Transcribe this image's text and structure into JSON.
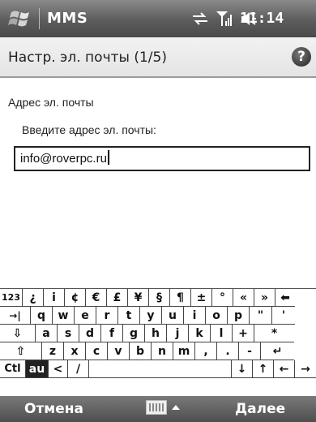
{
  "statusbar": {
    "app_name": "MMS",
    "time": "11:14",
    "icons": [
      "windows-logo",
      "sync-icon",
      "signal-icon",
      "volume-icon"
    ]
  },
  "header": {
    "title": "Настр. эл. почты (1/5)",
    "help_icon": "?"
  },
  "form": {
    "section_label": "Адрес эл. почты",
    "field_label": "Введите адрес эл. почты:",
    "email_value": "info@roverpc.ru"
  },
  "keyboard": {
    "rows": [
      [
        "123",
        "¿",
        "i",
        "¢",
        "€",
        "£",
        "¥",
        "§",
        "¶",
        "±",
        "°",
        "«",
        "»",
        "⬅"
      ],
      [
        "→|",
        "q",
        "w",
        "e",
        "r",
        "t",
        "y",
        "u",
        "i",
        "o",
        "p",
        "\"",
        "'"
      ],
      [
        "⇩",
        "a",
        "s",
        "d",
        "f",
        "g",
        "h",
        "j",
        "k",
        "l",
        "+",
        "*"
      ],
      [
        "⇧",
        "z",
        "x",
        "c",
        "v",
        "b",
        "n",
        "m",
        ",",
        ".",
        "-",
        "↵"
      ],
      [
        "Ctl",
        "au",
        "<",
        "/",
        "",
        "↓",
        "↑",
        "←",
        "→"
      ]
    ]
  },
  "softkeys": {
    "left": "Отмена",
    "right": "Далее"
  }
}
